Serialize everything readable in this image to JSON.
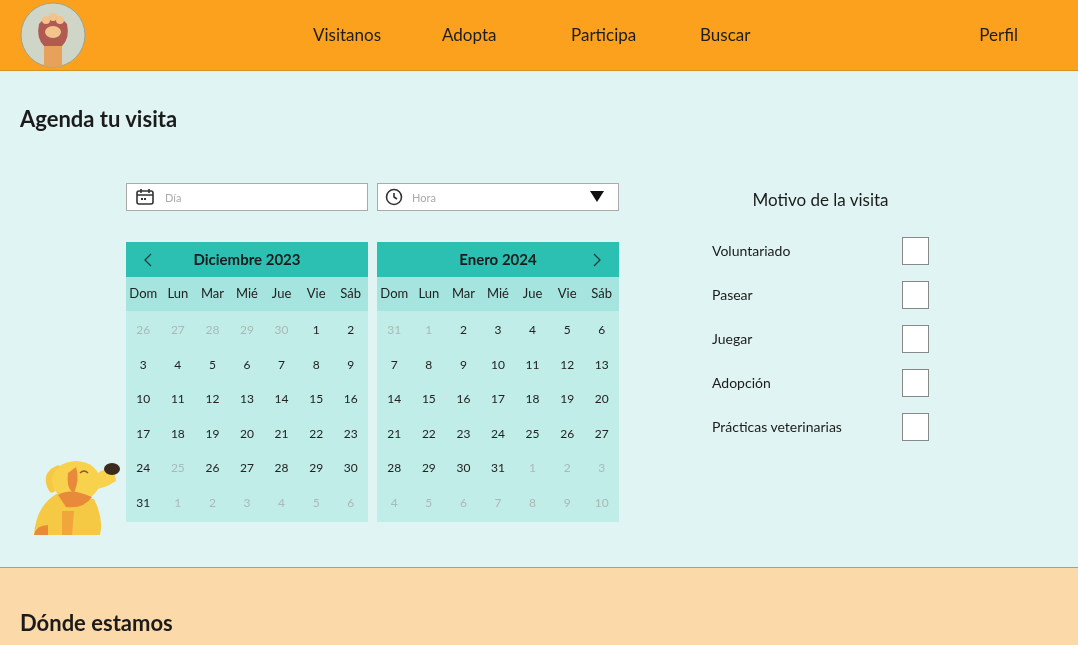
{
  "nav": {
    "links": [
      {
        "label": "Visitanos"
      },
      {
        "label": "Adopta"
      },
      {
        "label": "Participa"
      },
      {
        "label": "Buscar"
      }
    ],
    "profile": "Perfil"
  },
  "title": "Agenda tu visita",
  "day_field": {
    "placeholder": "Día"
  },
  "time_field": {
    "placeholder": "Hora"
  },
  "calendars": [
    {
      "month": "Diciembre 2023",
      "kind": "prev",
      "weekdays": [
        "Dom",
        "Lun",
        "Mar",
        "Mié",
        "Jue",
        "Vie",
        "Sáb"
      ],
      "days": [
        {
          "d": "26",
          "disabled": true
        },
        {
          "d": "27",
          "disabled": true
        },
        {
          "d": "28",
          "disabled": true
        },
        {
          "d": "29",
          "disabled": true
        },
        {
          "d": "30",
          "disabled": true
        },
        {
          "d": "1",
          "disabled": false
        },
        {
          "d": "2",
          "disabled": false
        },
        {
          "d": "3",
          "disabled": false
        },
        {
          "d": "4",
          "disabled": false
        },
        {
          "d": "5",
          "disabled": false
        },
        {
          "d": "6",
          "disabled": false
        },
        {
          "d": "7",
          "disabled": false
        },
        {
          "d": "8",
          "disabled": false
        },
        {
          "d": "9",
          "disabled": false
        },
        {
          "d": "10",
          "disabled": false
        },
        {
          "d": "11",
          "disabled": false
        },
        {
          "d": "12",
          "disabled": false
        },
        {
          "d": "13",
          "disabled": false
        },
        {
          "d": "14",
          "disabled": false
        },
        {
          "d": "15",
          "disabled": false
        },
        {
          "d": "16",
          "disabled": false
        },
        {
          "d": "17",
          "disabled": false
        },
        {
          "d": "18",
          "disabled": false
        },
        {
          "d": "19",
          "disabled": false
        },
        {
          "d": "20",
          "disabled": false
        },
        {
          "d": "21",
          "disabled": false
        },
        {
          "d": "22",
          "disabled": false
        },
        {
          "d": "23",
          "disabled": false
        },
        {
          "d": "24",
          "disabled": false
        },
        {
          "d": "25",
          "disabled": true
        },
        {
          "d": "26",
          "disabled": false
        },
        {
          "d": "27",
          "disabled": false
        },
        {
          "d": "28",
          "disabled": false
        },
        {
          "d": "29",
          "disabled": false
        },
        {
          "d": "30",
          "disabled": false
        },
        {
          "d": "31",
          "disabled": false
        },
        {
          "d": "1",
          "disabled": true
        },
        {
          "d": "2",
          "disabled": true
        },
        {
          "d": "3",
          "disabled": true
        },
        {
          "d": "4",
          "disabled": true
        },
        {
          "d": "5",
          "disabled": true
        },
        {
          "d": "6",
          "disabled": true
        }
      ]
    },
    {
      "month": "Enero 2024",
      "kind": "next",
      "weekdays": [
        "Dom",
        "Lun",
        "Mar",
        "Mié",
        "Jue",
        "Vie",
        "Sáb"
      ],
      "days": [
        {
          "d": "31",
          "disabled": true
        },
        {
          "d": "1",
          "disabled": true
        },
        {
          "d": "2",
          "disabled": false
        },
        {
          "d": "3",
          "disabled": false
        },
        {
          "d": "4",
          "disabled": false
        },
        {
          "d": "5",
          "disabled": false
        },
        {
          "d": "6",
          "disabled": false
        },
        {
          "d": "7",
          "disabled": false
        },
        {
          "d": "8",
          "disabled": false
        },
        {
          "d": "9",
          "disabled": false
        },
        {
          "d": "10",
          "disabled": false
        },
        {
          "d": "11",
          "disabled": false
        },
        {
          "d": "12",
          "disabled": false
        },
        {
          "d": "13",
          "disabled": false
        },
        {
          "d": "14",
          "disabled": false
        },
        {
          "d": "15",
          "disabled": false
        },
        {
          "d": "16",
          "disabled": false
        },
        {
          "d": "17",
          "disabled": false
        },
        {
          "d": "18",
          "disabled": false
        },
        {
          "d": "19",
          "disabled": false
        },
        {
          "d": "20",
          "disabled": false
        },
        {
          "d": "21",
          "disabled": false
        },
        {
          "d": "22",
          "disabled": false
        },
        {
          "d": "23",
          "disabled": false
        },
        {
          "d": "24",
          "disabled": false
        },
        {
          "d": "25",
          "disabled": false
        },
        {
          "d": "26",
          "disabled": false
        },
        {
          "d": "27",
          "disabled": false
        },
        {
          "d": "28",
          "disabled": false
        },
        {
          "d": "29",
          "disabled": false
        },
        {
          "d": "30",
          "disabled": false
        },
        {
          "d": "31",
          "disabled": false
        },
        {
          "d": "1",
          "disabled": true
        },
        {
          "d": "2",
          "disabled": true
        },
        {
          "d": "3",
          "disabled": true
        },
        {
          "d": "4",
          "disabled": true
        },
        {
          "d": "5",
          "disabled": true
        },
        {
          "d": "6",
          "disabled": true
        },
        {
          "d": "7",
          "disabled": true
        },
        {
          "d": "8",
          "disabled": true
        },
        {
          "d": "9",
          "disabled": true
        },
        {
          "d": "10",
          "disabled": true
        }
      ]
    }
  ],
  "reasons": {
    "title": "Motivo de la visita",
    "options": [
      {
        "label": "Voluntariado",
        "checked": false
      },
      {
        "label": "Pasear",
        "checked": false
      },
      {
        "label": "Juegar",
        "checked": false
      },
      {
        "label": "Adopción",
        "checked": false
      },
      {
        "label": "Prácticas veterinarias",
        "checked": false
      }
    ]
  },
  "location": {
    "title": "Dónde estamos"
  }
}
